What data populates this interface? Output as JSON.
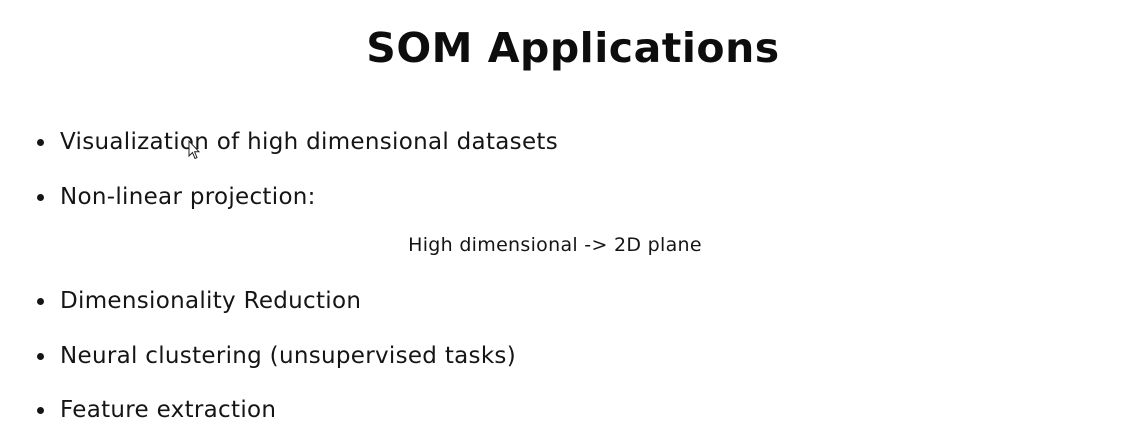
{
  "slide": {
    "title": "SOM Applications",
    "bullets": [
      "Visualization of high dimensional datasets",
      "Non-linear projection:",
      "Dimensionality Reduction",
      "Neural clustering (unsupervised tasks)",
      "Feature extraction"
    ],
    "sub_line": "High dimensional -> 2D plane"
  },
  "icons": {
    "cursor": "mouse-pointer-icon"
  }
}
